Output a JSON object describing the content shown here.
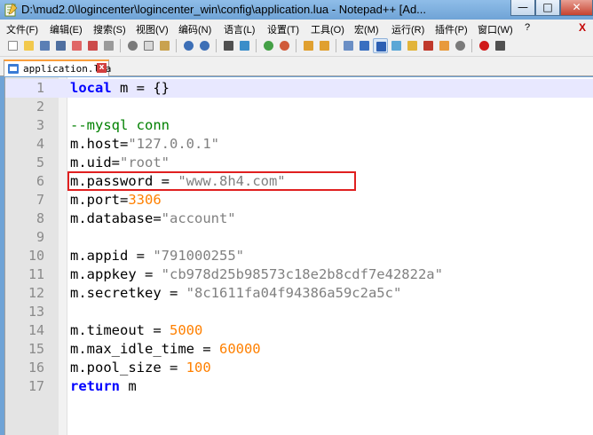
{
  "window": {
    "title": "D:\\mud2.0\\logincenter\\logincenter_win\\config\\application.lua - Notepad++ [Ad...",
    "minimize": "—",
    "maximize": "□",
    "close": "✕"
  },
  "menu": {
    "items": [
      "文件(F)",
      "编辑(E)",
      "搜索(S)",
      "视图(V)",
      "编码(N)",
      "语言(L)",
      "设置(T)",
      "工具(O)",
      "宏(M)",
      "运行(R)",
      "插件(P)",
      "窗口(W)",
      "?"
    ],
    "close_doc": "X"
  },
  "toolbar": {
    "buttons": [
      "new-icon",
      "open-icon",
      "save-icon",
      "save-all-icon",
      "close-icon",
      "close-all-icon",
      "print-icon",
      "cut-icon",
      "copy-icon",
      "paste-icon",
      "undo-icon",
      "redo-icon",
      "find-icon",
      "replace-icon",
      "zoom-in-icon",
      "zoom-out-icon",
      "sync-v-icon",
      "sync-h-icon",
      "word-wrap-icon",
      "all-chars-icon",
      "indent-guide-icon",
      "udl-icon",
      "doc-map-icon",
      "function-list-icon",
      "folder-icon",
      "monitor-icon",
      "record-icon",
      "stop-icon"
    ]
  },
  "tab": {
    "label": "application.lua",
    "close": "x"
  },
  "editor": {
    "lines": [
      {
        "num": "1",
        "parts": [
          {
            "t": "kw",
            "v": "local"
          },
          {
            "t": "p",
            "v": " m = {}"
          }
        ]
      },
      {
        "num": "2",
        "parts": []
      },
      {
        "num": "3",
        "parts": [
          {
            "t": "cm",
            "v": "--mysql conn"
          }
        ]
      },
      {
        "num": "4",
        "parts": [
          {
            "t": "p",
            "v": "m.host="
          },
          {
            "t": "st",
            "v": "\"127.0.0.1\""
          }
        ]
      },
      {
        "num": "5",
        "parts": [
          {
            "t": "p",
            "v": "m.uid="
          },
          {
            "t": "st",
            "v": "\"root\""
          }
        ]
      },
      {
        "num": "6",
        "parts": [
          {
            "t": "p",
            "v": "m.password = "
          },
          {
            "t": "st",
            "v": "\"www.8h4.com\""
          }
        ]
      },
      {
        "num": "7",
        "parts": [
          {
            "t": "p",
            "v": "m.port="
          },
          {
            "t": "nm",
            "v": "3306"
          }
        ]
      },
      {
        "num": "8",
        "parts": [
          {
            "t": "p",
            "v": "m.database="
          },
          {
            "t": "st",
            "v": "\"account\""
          }
        ]
      },
      {
        "num": "9",
        "parts": []
      },
      {
        "num": "10",
        "parts": [
          {
            "t": "p",
            "v": "m.appid = "
          },
          {
            "t": "st",
            "v": "\"791000255\""
          }
        ]
      },
      {
        "num": "11",
        "parts": [
          {
            "t": "p",
            "v": "m.appkey = "
          },
          {
            "t": "st",
            "v": "\"cb978d25b98573c18e2b8cdf7e42822a\""
          }
        ]
      },
      {
        "num": "12",
        "parts": [
          {
            "t": "p",
            "v": "m.secretkey = "
          },
          {
            "t": "st",
            "v": "\"8c1611fa04f94386a59c2a5c\""
          }
        ]
      },
      {
        "num": "13",
        "parts": []
      },
      {
        "num": "14",
        "parts": [
          {
            "t": "p",
            "v": "m.timeout = "
          },
          {
            "t": "nm",
            "v": "5000"
          }
        ]
      },
      {
        "num": "15",
        "parts": [
          {
            "t": "p",
            "v": "m.max_idle_time = "
          },
          {
            "t": "nm",
            "v": "60000"
          }
        ]
      },
      {
        "num": "16",
        "parts": [
          {
            "t": "p",
            "v": "m.pool_size = "
          },
          {
            "t": "nm",
            "v": "100"
          }
        ]
      },
      {
        "num": "17",
        "parts": [
          {
            "t": "kw",
            "v": "return"
          },
          {
            "t": "p",
            "v": " m"
          }
        ]
      }
    ],
    "current_line": "1",
    "highlighted_line": "6"
  },
  "colors": {
    "keyword": "#0000ff",
    "comment": "#008000",
    "string": "#808080",
    "number": "#ff8000",
    "highlight_box": "#e02020",
    "tab_accent": "#fa9e3c"
  }
}
